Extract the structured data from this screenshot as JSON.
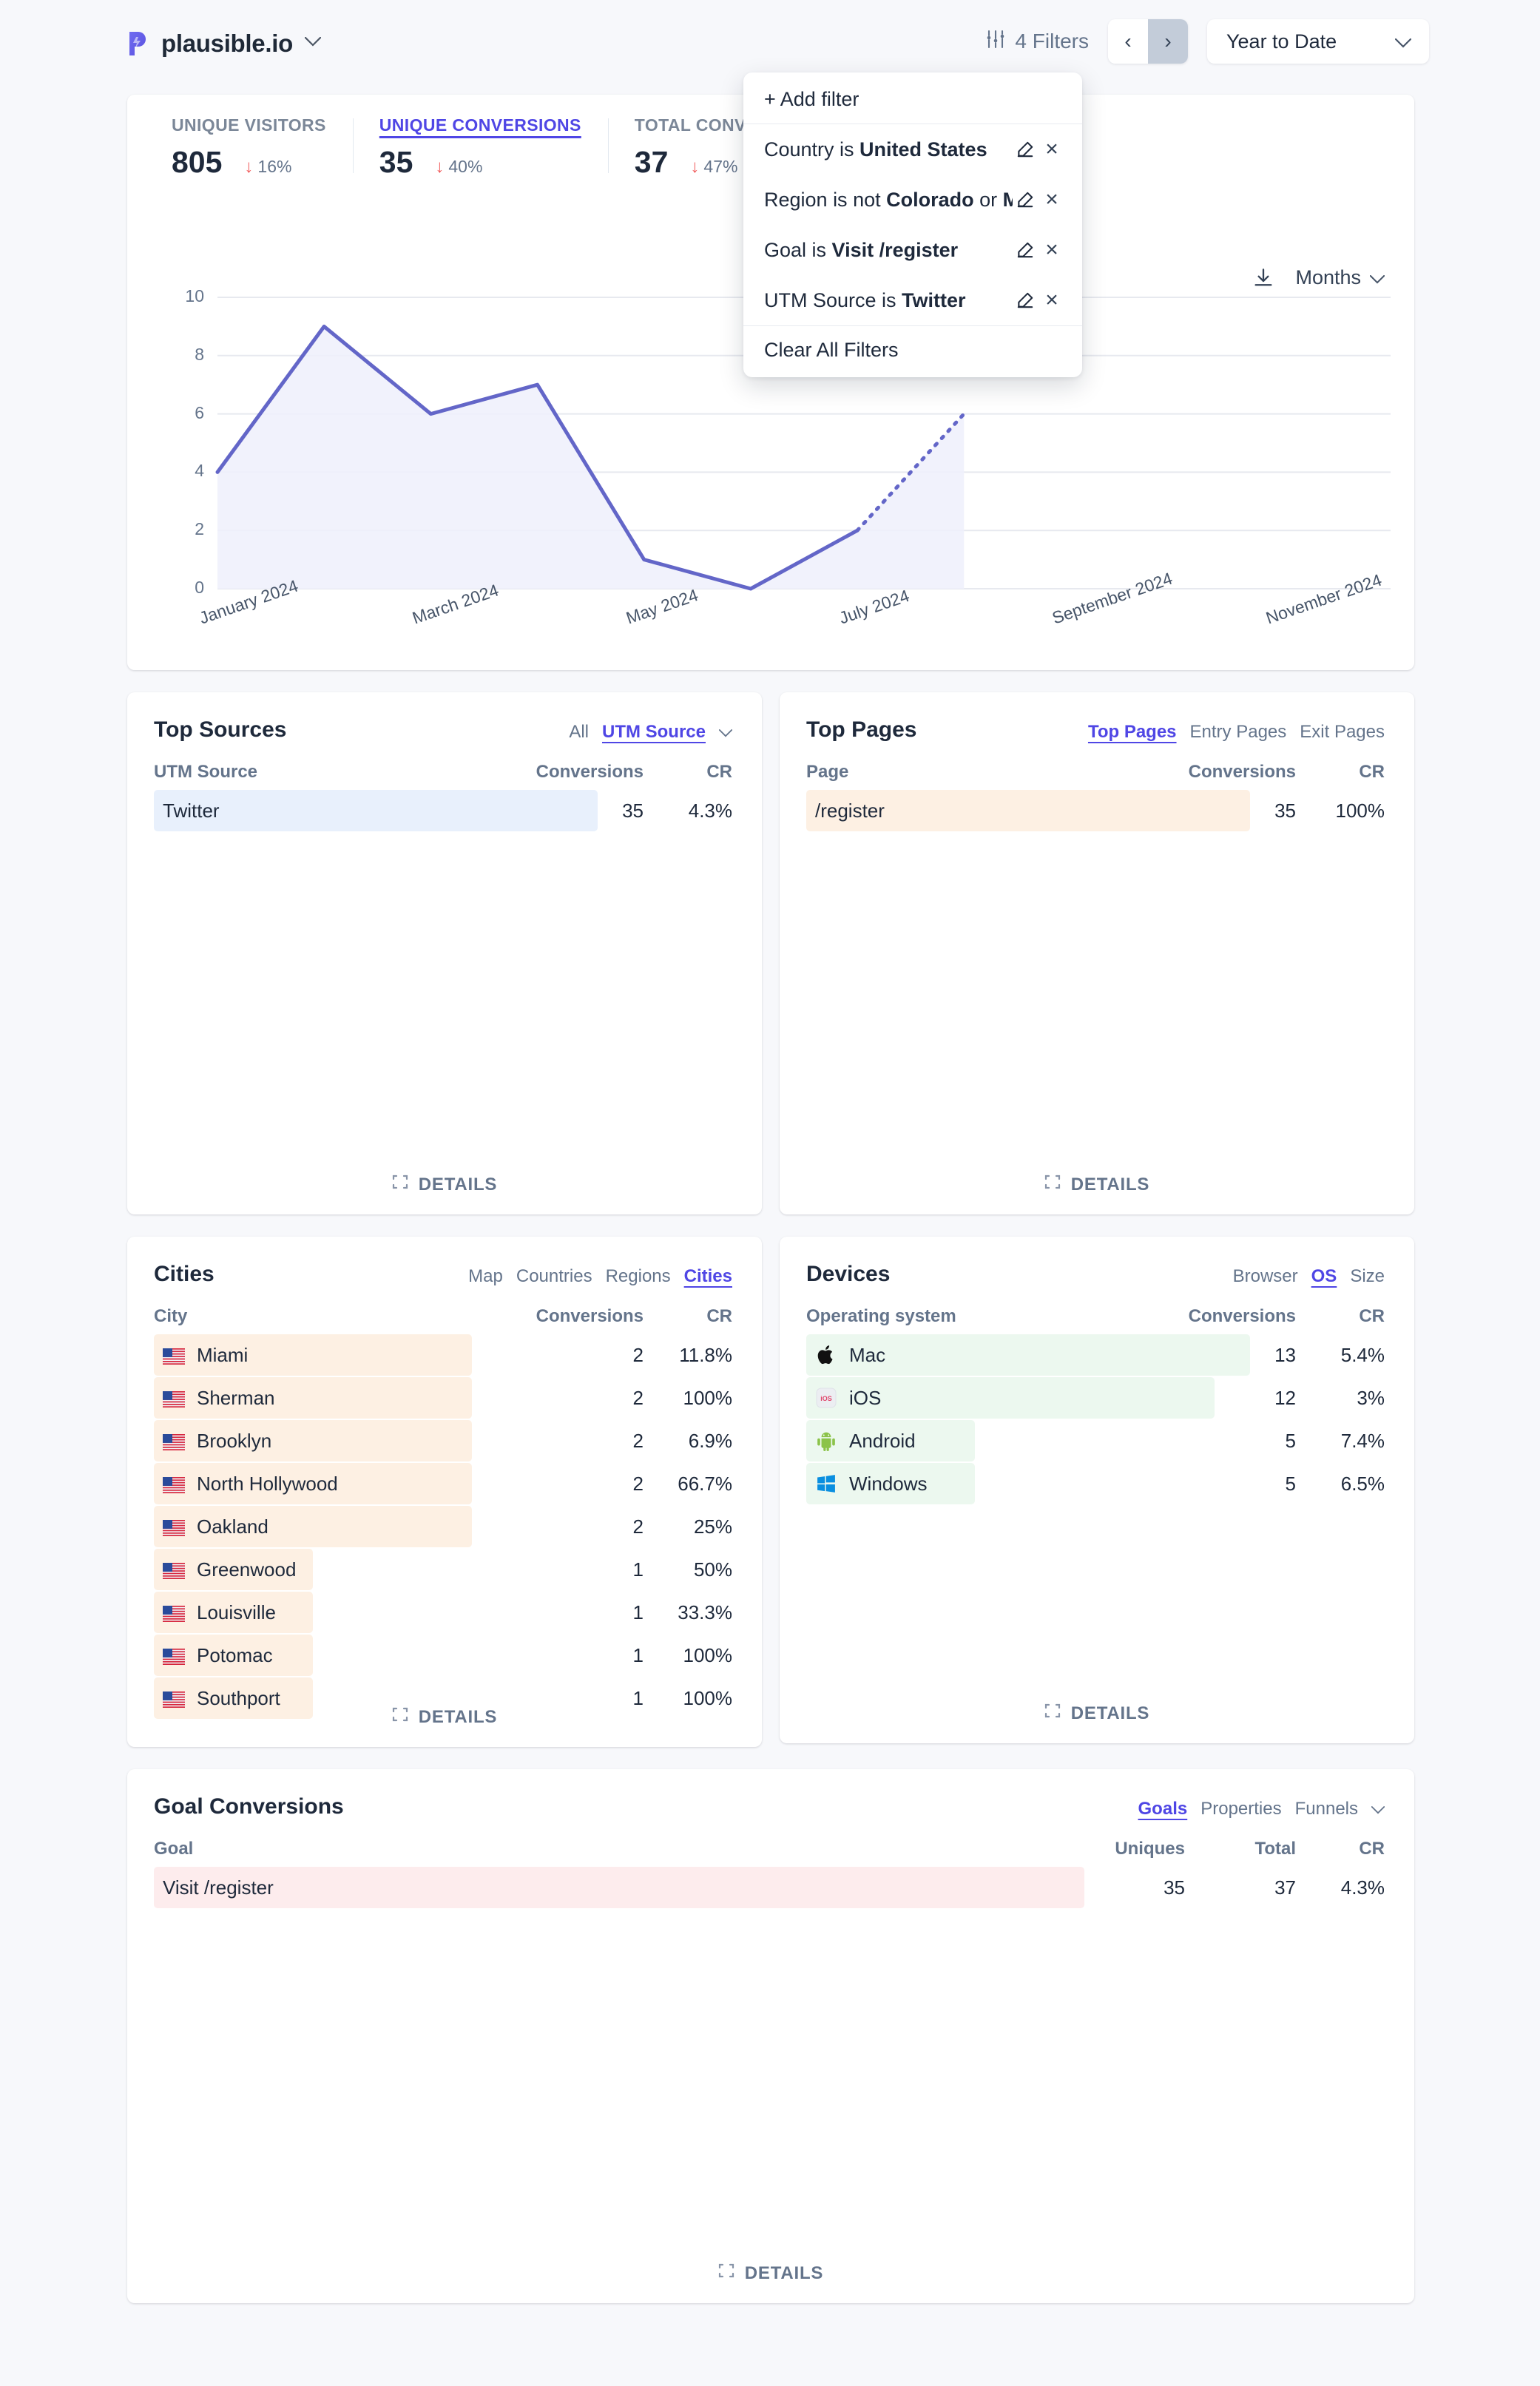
{
  "header": {
    "site_name": "plausible.io",
    "site_chevron": "chevron-down",
    "filters_label": "4 Filters",
    "prev_label": "‹",
    "next_label": "›",
    "date_range": "Year to Date"
  },
  "filter_menu": {
    "add_filter": "+ Add filter",
    "clear_all": "Clear All Filters",
    "rows": [
      {
        "prefix": "Country is ",
        "value": "United States",
        "suffix": ""
      },
      {
        "prefix": "Region is not ",
        "value": "Colorado",
        "suffix": " or ",
        "value2": "Min..."
      },
      {
        "prefix": "Goal is ",
        "value": "Visit /register",
        "suffix": ""
      },
      {
        "prefix": "UTM Source is ",
        "value": "Twitter",
        "suffix": ""
      }
    ]
  },
  "metrics": [
    {
      "label": "Unique Visitors",
      "value": "805",
      "delta": "16%",
      "dir": "down",
      "active": false
    },
    {
      "label": "Unique Conversions",
      "value": "35",
      "delta": "40%",
      "dir": "down",
      "active": true
    },
    {
      "label": "Total Conversions",
      "value": "37",
      "delta": "47%",
      "dir": "down",
      "active": false
    }
  ],
  "graph": {
    "download_icon": "download-icon",
    "interval": "Months",
    "interval_chevron": "chevron-down"
  },
  "chart_data": {
    "type": "area",
    "title": "",
    "xlabel": "",
    "ylabel": "",
    "ylim": [
      0,
      10
    ],
    "yticks": [
      0,
      2,
      4,
      6,
      8,
      10
    ],
    "grid": true,
    "legend": "none",
    "x_tick_labels": [
      "January 2024",
      "March 2024",
      "May 2024",
      "July 2024",
      "September 2024",
      "November 2024"
    ],
    "categories": [
      "January 2024",
      "February 2024",
      "March 2024",
      "April 2024",
      "May 2024",
      "June 2024",
      "July 2024",
      "August 2024",
      "September 2024",
      "October 2024",
      "November 2024",
      "December 2024"
    ],
    "series": [
      {
        "name": "Unique Conversions",
        "values": [
          4,
          9,
          6,
          7,
          1,
          0,
          2,
          6,
          null,
          null,
          null,
          null
        ],
        "dashed_from_index": 6,
        "color": "#6366c8",
        "fill": "#eef0fb"
      }
    ]
  },
  "top_sources": {
    "title": "Top Sources",
    "tabs": [
      {
        "label": "All",
        "on": false
      },
      {
        "label": "UTM Source",
        "on": true
      }
    ],
    "tabs_chevron": "chevron-down",
    "columns": {
      "name": "UTM Source",
      "conversions": "Conversions",
      "cr": "CR"
    },
    "rows": [
      {
        "name": "Twitter",
        "conversions": "35",
        "cr": "4.3%",
        "pct": 100
      }
    ],
    "details": "DETAILS"
  },
  "top_pages": {
    "title": "Top Pages",
    "tabs": [
      {
        "label": "Top Pages",
        "on": true
      },
      {
        "label": "Entry Pages",
        "on": false
      },
      {
        "label": "Exit Pages",
        "on": false
      }
    ],
    "columns": {
      "name": "Page",
      "conversions": "Conversions",
      "cr": "CR"
    },
    "rows": [
      {
        "name": "/register",
        "conversions": "35",
        "cr": "100%",
        "pct": 100
      }
    ],
    "details": "DETAILS"
  },
  "cities": {
    "title": "Cities",
    "tabs": [
      {
        "label": "Map",
        "on": false
      },
      {
        "label": "Countries",
        "on": false
      },
      {
        "label": "Regions",
        "on": false
      },
      {
        "label": "Cities",
        "on": true
      }
    ],
    "columns": {
      "name": "City",
      "conversions": "Conversions",
      "cr": "CR"
    },
    "rows": [
      {
        "flag": "us-flag-icon",
        "name": "Miami",
        "conversions": "2",
        "cr": "11.8%",
        "pct": 100
      },
      {
        "flag": "us-flag-icon",
        "name": "Sherman",
        "conversions": "2",
        "cr": "100%",
        "pct": 100
      },
      {
        "flag": "us-flag-icon",
        "name": "Brooklyn",
        "conversions": "2",
        "cr": "6.9%",
        "pct": 100
      },
      {
        "flag": "us-flag-icon",
        "name": "North Hollywood",
        "conversions": "2",
        "cr": "66.7%",
        "pct": 100
      },
      {
        "flag": "us-flag-icon",
        "name": "Oakland",
        "conversions": "2",
        "cr": "25%",
        "pct": 100
      },
      {
        "flag": "us-flag-icon",
        "name": "Greenwood",
        "conversions": "1",
        "cr": "50%",
        "pct": 50
      },
      {
        "flag": "us-flag-icon",
        "name": "Louisville",
        "conversions": "1",
        "cr": "33.3%",
        "pct": 50
      },
      {
        "flag": "us-flag-icon",
        "name": "Potomac",
        "conversions": "1",
        "cr": "100%",
        "pct": 50
      },
      {
        "flag": "us-flag-icon",
        "name": "Southport",
        "conversions": "1",
        "cr": "100%",
        "pct": 50
      }
    ],
    "details": "DETAILS"
  },
  "devices": {
    "title": "Devices",
    "tabs": [
      {
        "label": "Browser",
        "on": false
      },
      {
        "label": "OS",
        "on": true
      },
      {
        "label": "Size",
        "on": false
      }
    ],
    "columns": {
      "name": "Operating system",
      "conversions": "Conversions",
      "cr": "CR"
    },
    "rows": [
      {
        "icon": "apple-icon",
        "name": "Mac",
        "conversions": "13",
        "cr": "5.4%",
        "pct": 100
      },
      {
        "icon": "ios-icon",
        "name": "iOS",
        "conversions": "12",
        "cr": "3%",
        "pct": 92
      },
      {
        "icon": "android-icon",
        "name": "Android",
        "conversions": "5",
        "cr": "7.4%",
        "pct": 38
      },
      {
        "icon": "windows-icon",
        "name": "Windows",
        "conversions": "5",
        "cr": "6.5%",
        "pct": 38
      }
    ],
    "details": "DETAILS"
  },
  "goals": {
    "title": "Goal Conversions",
    "tabs": [
      {
        "label": "Goals",
        "on": true
      },
      {
        "label": "Properties",
        "on": false
      },
      {
        "label": "Funnels",
        "on": false
      }
    ],
    "tabs_chevron": "chevron-down",
    "columns": {
      "name": "Goal",
      "uniques": "Uniques",
      "total": "Total",
      "cr": "CR"
    },
    "rows": [
      {
        "name": "Visit /register",
        "uniques": "35",
        "total": "37",
        "cr": "4.3%",
        "pct": 100
      }
    ],
    "details": "DETAILS"
  },
  "colors": {
    "accent": "#4f46e5",
    "line": "#6366c8",
    "area": "#eef0fb",
    "down": "#f15b5b",
    "bg": "#f7f8fb",
    "bar_blue": "#e8f0fc",
    "bar_orange": "#fdf0e3",
    "bar_green": "#ecf8ef",
    "bar_red": "#fdeced"
  }
}
